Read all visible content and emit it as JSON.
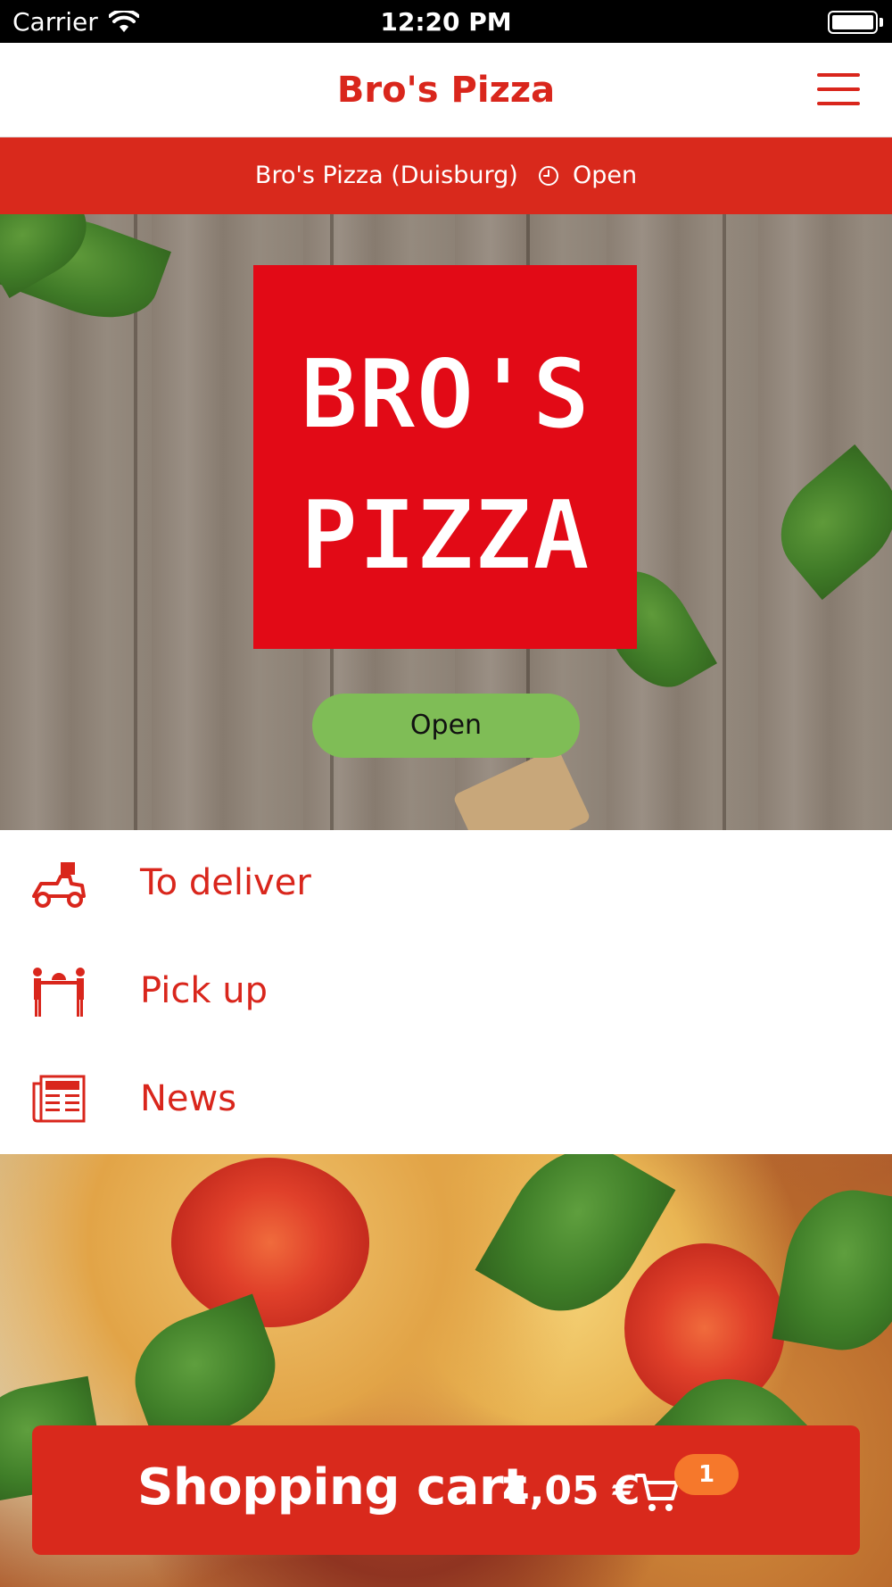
{
  "status_bar": {
    "carrier": "Carrier",
    "time": "12:20 PM",
    "icons": [
      "wifi-icon",
      "battery-icon"
    ]
  },
  "header": {
    "title": "Bro's Pizza",
    "menu_icon": "hamburger-menu-icon"
  },
  "store_bar": {
    "name": "Bro's Pizza (Duisburg)",
    "status_icon": "clock-icon",
    "status": "Open"
  },
  "hero": {
    "logo": {
      "line1": "BRO'S",
      "line2": "PIZZA"
    },
    "open_button_label": "Open"
  },
  "menu": {
    "items": [
      {
        "label": "To deliver",
        "icon": "delivery-scooter-icon"
      },
      {
        "label": "Pick up",
        "icon": "pickup-handover-icon"
      },
      {
        "label": "News",
        "icon": "newspaper-icon"
      }
    ]
  },
  "cart": {
    "label": "Shopping cart",
    "price": "4,05 €",
    "icon": "shopping-cart-icon",
    "badge_count": "1"
  },
  "colors": {
    "brand_red": "#d9261c",
    "logo_red": "#e20a16",
    "open_green": "#7fbd56",
    "badge_orange": "#f6782b"
  }
}
